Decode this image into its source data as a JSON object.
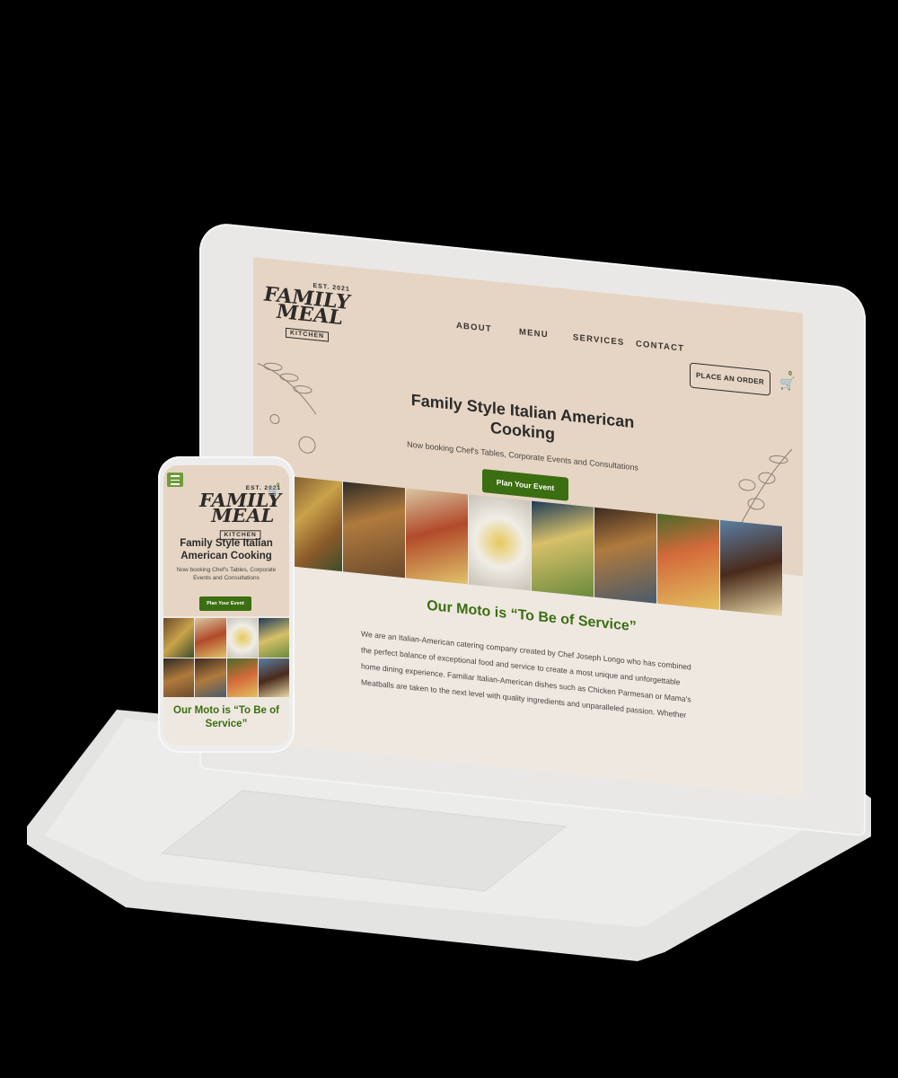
{
  "site": {
    "logo": {
      "est": "EST. 2021",
      "word1": "FAMILY",
      "word2": "MEAL",
      "word3": "KITCHEN"
    },
    "nav": [
      "ABOUT",
      "MENU",
      "SERVICES",
      "CONTACT"
    ],
    "order_button": "PLACE AN ORDER",
    "cart_count": "0",
    "hero": {
      "title": "Family Style Italian American Cooking",
      "subtitle": "Now booking Chef's Tables, Corporate Events and Consultations",
      "cta": "Plan Your Event"
    },
    "moto_heading": "Our Moto is “To Be of Service”",
    "intro_paragraph": "We are an Italian-American catering company created by Chef Joseph Longo who has combined the perfect balance of exceptional food and service to create a most unique and unforgettable home dining experience. Familiar Italian-American dishes such as Chicken Parmesan or Mama's Meatballs are taken to the next level with quality ingredients and unparalleled passion. Whether"
  },
  "phone": {
    "hero_title": "Family Style Italian American Cooking",
    "hero_subtitle": "Now booking Chef's Tables, Corporate Events and Consultations",
    "cta": "Plan Your Event",
    "moto_heading": "Our Moto is “To Be of Service”",
    "cart_count": "0"
  },
  "colors": {
    "brand_green": "#3b6e10",
    "header_bg": "#e6d5c4",
    "body_bg": "#efe8e1"
  }
}
